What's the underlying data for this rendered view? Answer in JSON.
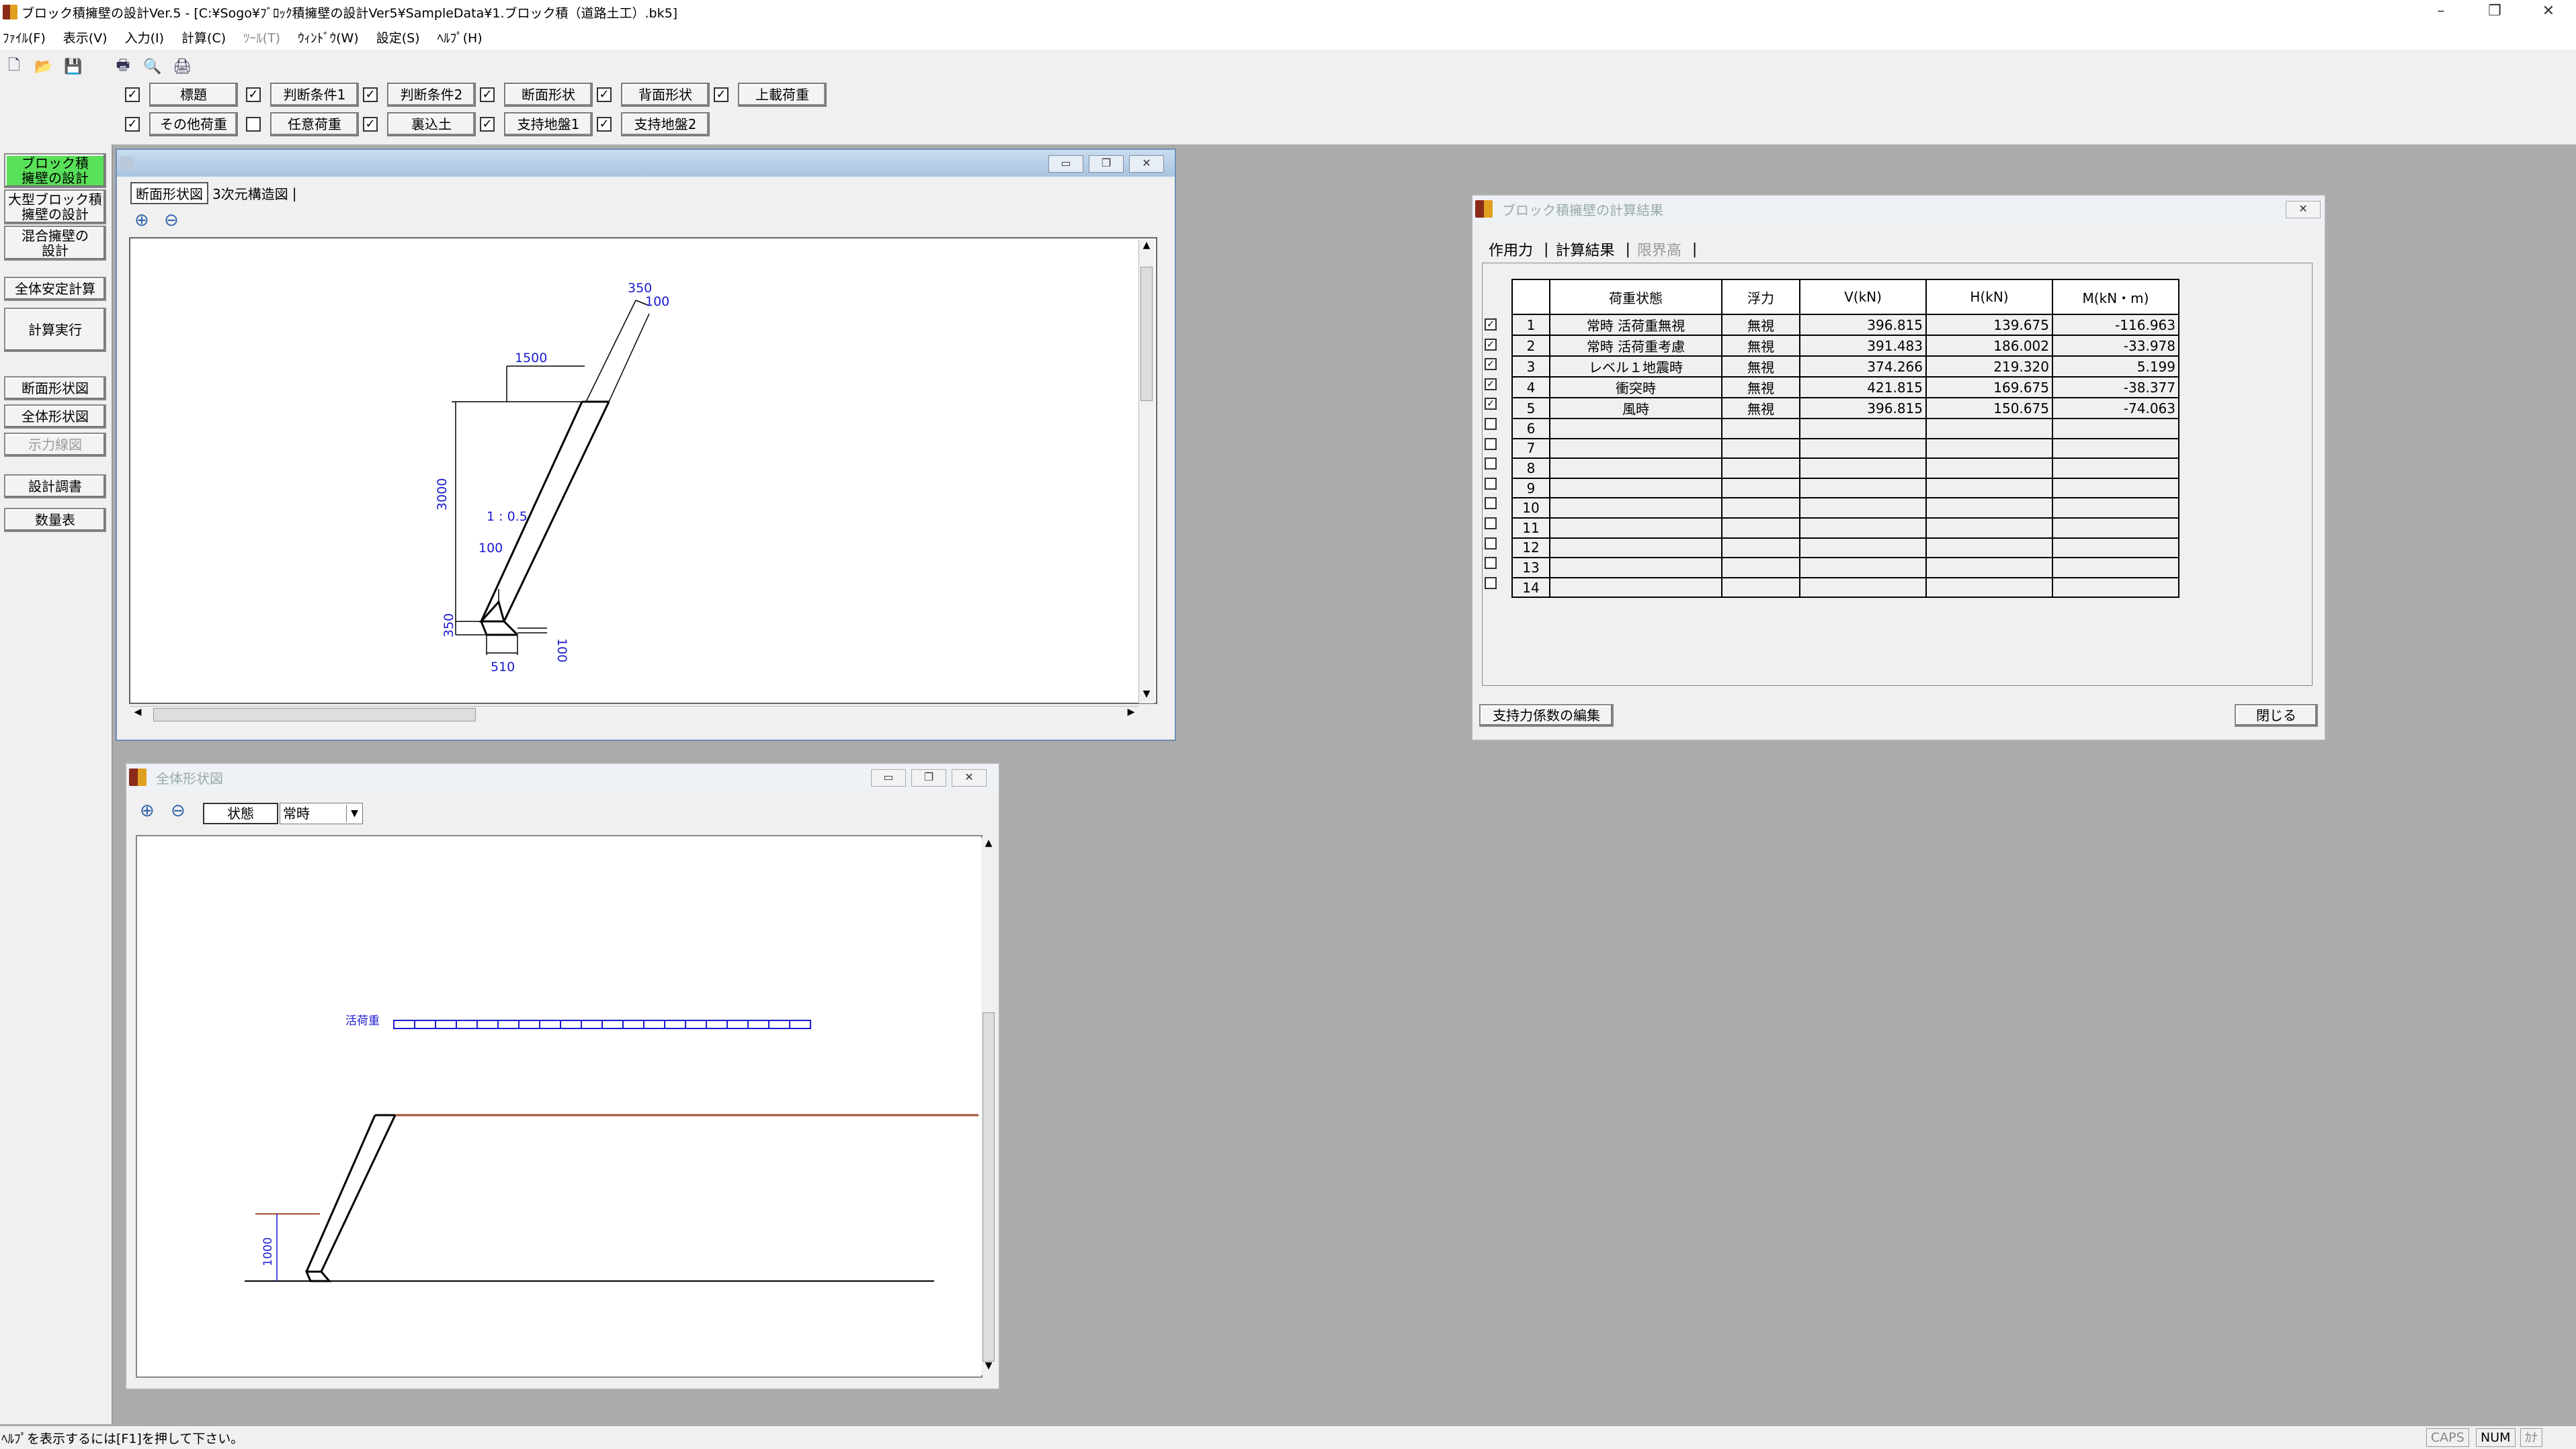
{
  "window": {
    "title": "ブロック積擁壁の設計Ver.5 - [C:¥Sogo¥ﾌﾞﾛｯｸ積擁壁の設計Ver5¥SampleData¥1.ブロック積（道路土工）.bk5]",
    "minimize": "–",
    "restore": "❐",
    "close": "✕"
  },
  "menu": [
    "ﾌｧｲﾙ(F)",
    "表示(V)",
    "入力(I)",
    "計算(C)",
    "ﾂｰﾙ(T)",
    "ｳｨﾝﾄﾞｳ(W)",
    "設定(S)",
    "ﾍﾙﾌﾟ(H)"
  ],
  "toolbar_icons": [
    "new-file-icon",
    "open-folder-icon",
    "save-icon",
    "print-icon",
    "print-preview-icon",
    "printer-setup-icon"
  ],
  "check_row1": [
    {
      "checked": true,
      "label": "標題"
    },
    {
      "checked": true,
      "label": "判断条件1"
    },
    {
      "checked": true,
      "label": "判断条件2"
    },
    {
      "checked": true,
      "label": "断面形状"
    },
    {
      "checked": true,
      "label": "背面形状"
    },
    {
      "checked": true,
      "label": "上載荷重"
    }
  ],
  "check_row2": [
    {
      "checked": true,
      "label": "その他荷重"
    },
    {
      "checked": false,
      "label": "任意荷重"
    },
    {
      "checked": true,
      "label": "裏込土"
    },
    {
      "checked": true,
      "label": "支持地盤1"
    },
    {
      "checked": true,
      "label": "支持地盤2"
    }
  ],
  "sidebar": {
    "design_block": "ブロック積\n擁壁の設計",
    "design_large": "大型ブロック積\n擁壁の設計",
    "design_mixed": "混合擁壁の\n設計",
    "stability": "全体安定計算",
    "run_calc": "計算実行",
    "section_view": "断面形状図",
    "overall_view": "全体形状図",
    "force_line": "示力線図",
    "design_report": "設計調書",
    "quantity": "数量表"
  },
  "section_window": {
    "tabs": [
      "断面形状図",
      "3次元構造図"
    ],
    "dims": {
      "top_width": "350",
      "top_offset": "100",
      "crest": "1500",
      "height": "3000",
      "slope": "1 : 0.5",
      "toe_top": "100",
      "base_h": "350",
      "toe_right": "100",
      "base_w": "510"
    }
  },
  "overall_window": {
    "title": "全体形状図",
    "state_label": "状態",
    "state_value": "常時",
    "live_load": "活荷重",
    "height_dim": "1000"
  },
  "result_window": {
    "title": "ブロック積擁壁の計算結果",
    "tabs": [
      "作用力",
      "計算結果",
      "限界高"
    ],
    "headers": [
      "荷重状態",
      "浮力",
      "V(kN)",
      "H(kN)",
      "M(kN・m)"
    ],
    "rows": [
      {
        "no": "1",
        "checked": true,
        "state": "常時 活荷重無視",
        "float": "無視",
        "v": "396.815",
        "h": "139.675",
        "m": "-116.963"
      },
      {
        "no": "2",
        "checked": true,
        "state": "常時 活荷重考慮",
        "float": "無視",
        "v": "391.483",
        "h": "186.002",
        "m": "-33.978"
      },
      {
        "no": "3",
        "checked": true,
        "state": "レベル１地震時",
        "float": "無視",
        "v": "374.266",
        "h": "219.320",
        "m": "5.199"
      },
      {
        "no": "4",
        "checked": true,
        "state": "衝突時",
        "float": "無視",
        "v": "421.815",
        "h": "169.675",
        "m": "-38.377"
      },
      {
        "no": "5",
        "checked": true,
        "state": "風時",
        "float": "無視",
        "v": "396.815",
        "h": "150.675",
        "m": "-74.063"
      },
      {
        "no": "6",
        "checked": false,
        "state": "",
        "float": "",
        "v": "",
        "h": "",
        "m": ""
      },
      {
        "no": "7",
        "checked": false,
        "state": "",
        "float": "",
        "v": "",
        "h": "",
        "m": ""
      },
      {
        "no": "8",
        "checked": false,
        "state": "",
        "float": "",
        "v": "",
        "h": "",
        "m": ""
      },
      {
        "no": "9",
        "checked": false,
        "state": "",
        "float": "",
        "v": "",
        "h": "",
        "m": ""
      },
      {
        "no": "10",
        "checked": false,
        "state": "",
        "float": "",
        "v": "",
        "h": "",
        "m": ""
      },
      {
        "no": "11",
        "checked": false,
        "state": "",
        "float": "",
        "v": "",
        "h": "",
        "m": ""
      },
      {
        "no": "12",
        "checked": false,
        "state": "",
        "float": "",
        "v": "",
        "h": "",
        "m": ""
      },
      {
        "no": "13",
        "checked": false,
        "state": "",
        "float": "",
        "v": "",
        "h": "",
        "m": ""
      },
      {
        "no": "14",
        "checked": false,
        "state": "",
        "float": "",
        "v": "",
        "h": "",
        "m": ""
      }
    ],
    "btn_edit": "支持力係数の編集",
    "btn_close": "閉じる"
  },
  "status": {
    "help": "ﾍﾙﾌﾟを表示するには[F1]を押して下さい。",
    "caps": "CAPS",
    "num": "NUM",
    "kana": "ｶﾅ"
  },
  "colors": {
    "active_button": "#58e058",
    "dim_blue": "#1a1ad0",
    "ground_brown": "#a0522d"
  }
}
